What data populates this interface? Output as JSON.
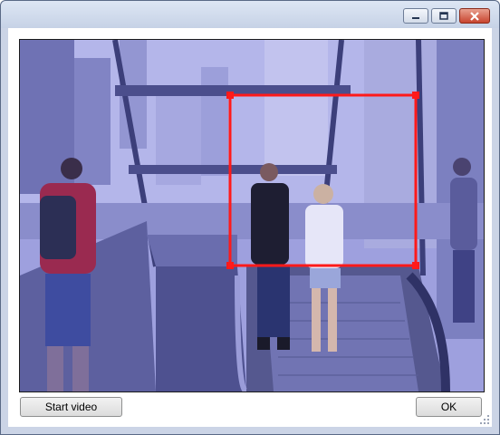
{
  "window": {
    "caption_buttons": [
      {
        "name": "minimize-button",
        "icon": "minimize-icon"
      },
      {
        "name": "maximize-button",
        "icon": "maximize-icon"
      },
      {
        "name": "close-button",
        "icon": "close-icon"
      }
    ]
  },
  "video": {
    "scene": "escalator-station-entrance",
    "tint_color": "#8c8fd0",
    "roi_color": "#ff1a1a"
  },
  "buttons": {
    "start_video": "Start video",
    "ok": "OK"
  }
}
